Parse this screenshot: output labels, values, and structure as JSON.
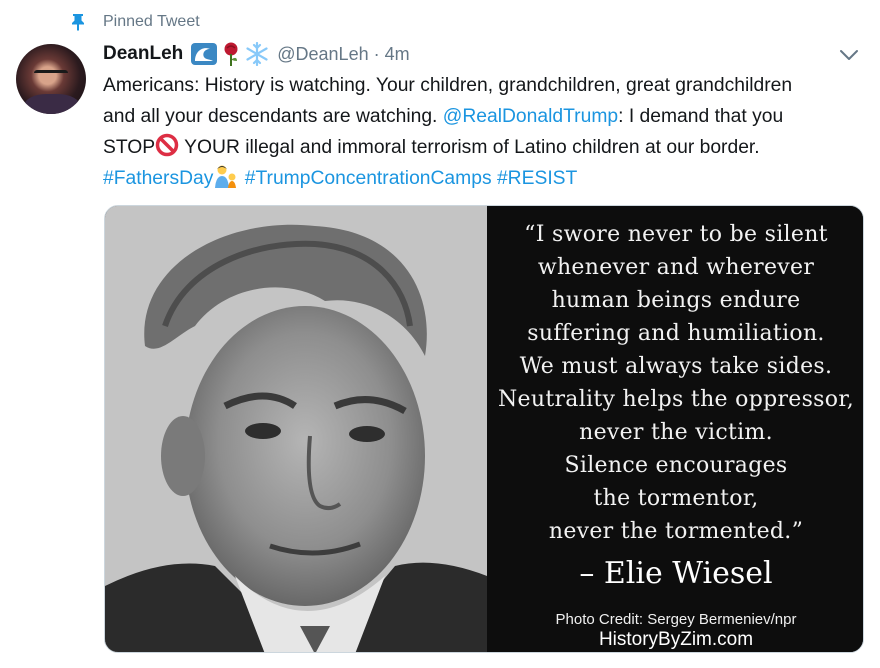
{
  "pinned": {
    "label": "Pinned Tweet",
    "icon": "pin-icon"
  },
  "tweet": {
    "display_name": "DeanLeh",
    "name_emojis": [
      "wave-icon",
      "rose-icon",
      "snowflake-icon"
    ],
    "handle": "@DeanLeh",
    "separator": "·",
    "time": "4m",
    "text": {
      "line1": "Americans: History is watching. Your children, grandchildren, great grandchildren",
      "line2": "and all your descendants are watching. ",
      "mention": "@RealDonaldTrump",
      "line2_after": ": I demand that you",
      "line3_start": "STOP",
      "line3_end": " YOUR illegal and immoral terrorism of Latino children at our border.",
      "hashtag1": "#FathersDay",
      "hashtag2": "#TrumpConcentrationCamps",
      "hashtag3": "#RESIST"
    }
  },
  "media": {
    "quote_lines": [
      "“I swore never to be silent",
      "whenever and wherever",
      "human beings endure",
      "suffering and humiliation.",
      "We must always take sides.",
      "Neutrality helps the oppressor,",
      "never the victim.",
      "Silence encourages",
      "the tormentor,",
      "never the tormented.”"
    ],
    "author": "– Elie Wiesel",
    "photo_credit": "Photo Credit: Sergey Bermeniev/npr",
    "site": "HistoryByZim.com"
  },
  "colors": {
    "link": "#1b95e0",
    "muted": "#657786",
    "text": "#14171a"
  }
}
